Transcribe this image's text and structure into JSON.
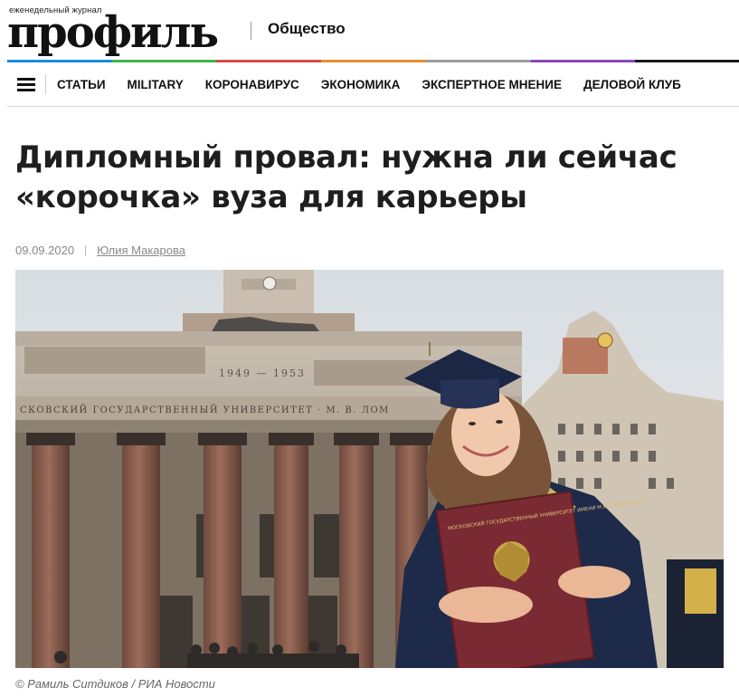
{
  "header": {
    "logo_small": "еженедельный журнал",
    "logo": "профиль",
    "section": "Общество"
  },
  "colors": {
    "strip": [
      "#1a8cd8",
      "#3db54a",
      "#d94b4b",
      "#e58f2f",
      "#9b9b9b",
      "#8b48b8",
      "#1a1a1a"
    ]
  },
  "nav": {
    "items": [
      "СТАТЬИ",
      "MILITARY",
      "КОРОНАВИРУС",
      "ЭКОНОМИКА",
      "ЭКСПЕРТНОЕ МНЕНИЕ",
      "ДЕЛОВОЙ КЛУБ"
    ]
  },
  "article": {
    "title_line1": "Дипломный провал: нужна ли сейчас",
    "title_line2": "«корочка» вуза для карьеры",
    "date": "09.09.2020",
    "author": "Юлия Макарова",
    "photo": {
      "years": "1949 — 1953",
      "frieze": "СКОВСКИЙ ГОСУДАРСТВЕННЫЙ УНИВЕРСИТЕТ · М. В. ЛОМ",
      "diploma_text": "МОСКОВСКИЙ ГОСУДАРСТВЕННЫЙ УНИВЕРСИТЕТ ИМЕНИ М.В.ЛОМОНОСОВА"
    },
    "caption": "© Рамиль Ситдиков / РИА Новости"
  }
}
